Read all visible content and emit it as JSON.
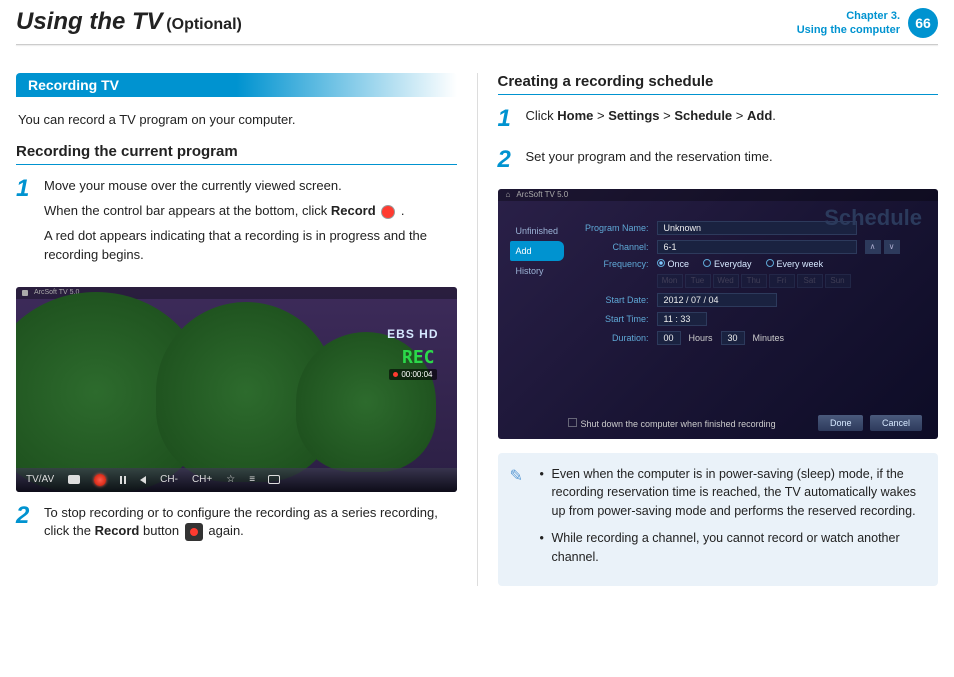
{
  "header": {
    "title_main": "Using the TV",
    "title_optional": "(Optional)",
    "chapter_line1": "Chapter 3.",
    "chapter_line2": "Using the computer",
    "page_num": "66"
  },
  "left": {
    "section_title": "Recording TV",
    "intro": "You can record a TV program on your computer.",
    "sub1": "Recording the current program",
    "step1_num": "1",
    "step1_a": "Move your mouse over the currently viewed screen.",
    "step1_b_pre": "When the control bar appears at the bottom, click ",
    "step1_b_bold": "Record",
    "step1_b_post": " .",
    "step1_c": "A red dot appears indicating that a recording is in progress and the recording begins.",
    "step2_num": "2",
    "step2_pre": "To stop recording or to configure the recording as a series recording, click the ",
    "step2_bold": "Record",
    "step2_mid": " button ",
    "step2_post": " again.",
    "tv": {
      "app_label": "ArcSoft TV 5.0",
      "ebs": "EBS HD",
      "rec": "REC",
      "time": "00:00:04",
      "bar_tvav": "TV/AV",
      "bar_chm": "CH-",
      "bar_chp": "CH+"
    }
  },
  "right": {
    "sub1": "Creating a recording schedule",
    "step1_num": "1",
    "step1_pre": "Click ",
    "step1_b1": "Home",
    "step1_s1": " > ",
    "step1_b2": "Settings",
    "step1_s2": " > ",
    "step1_b3": "Schedule",
    "step1_s3": " > ",
    "step1_b4": "Add",
    "step1_post": ".",
    "step2_num": "2",
    "step2": "Set your program and the reservation time.",
    "sched": {
      "app_label": "ArcSoft TV 5.0",
      "title": "Schedule",
      "side_unfinished": "Unfinished",
      "side_add": "Add",
      "side_history": "History",
      "l_program": "Program Name:",
      "v_program": "Unknown",
      "l_channel": "Channel:",
      "v_channel": "6-1",
      "l_freq": "Frequency:",
      "freq_once": "Once",
      "freq_everyday": "Everyday",
      "freq_everyweek": "Every week",
      "days": [
        "Mon",
        "Tue",
        "Wed",
        "Thu",
        "Fri",
        "Sat",
        "Sun"
      ],
      "l_start_date": "Start Date:",
      "v_start_date": "2012 / 07 / 04",
      "l_start_time": "Start Time:",
      "v_start_time": "11 : 33",
      "l_duration": "Duration:",
      "v_dur_h": "00",
      "u_hours": "Hours",
      "v_dur_m": "30",
      "u_minutes": "Minutes",
      "shutdown": "Shut down the computer when finished recording",
      "done": "Done",
      "cancel": "Cancel"
    },
    "note": {
      "li1": "Even when the computer is in power-saving (sleep) mode, if the recording reservation time is reached, the TV automatically wakes up from power-saving mode and performs the reserved recording.",
      "li2": "While recording a channel, you cannot record or watch another channel."
    }
  }
}
